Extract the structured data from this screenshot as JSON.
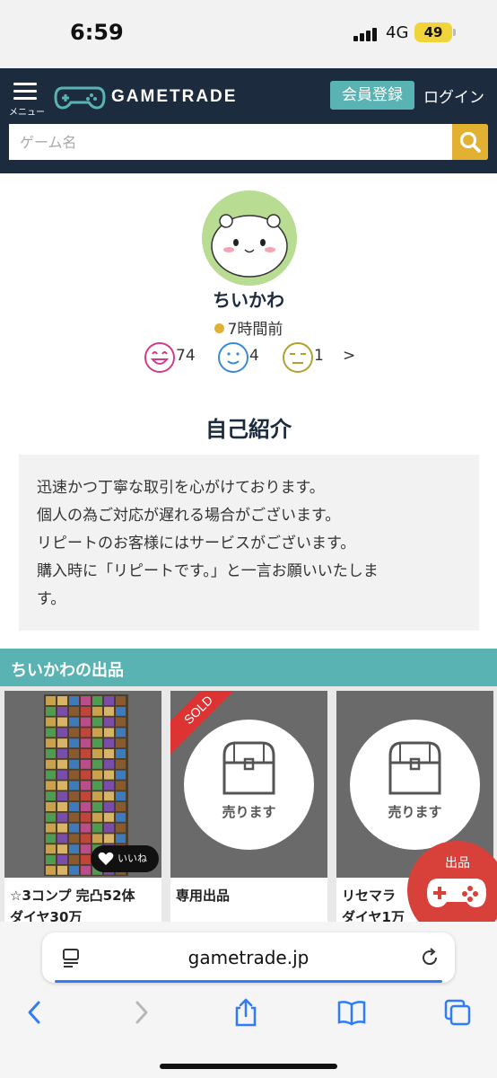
{
  "status_bar": {
    "time": "6:59",
    "network": "4G",
    "battery": "49"
  },
  "header": {
    "menu_label": "メニュー",
    "logo_text": "GAMETRADE",
    "register_label": "会員登録",
    "login_label": "ログイン",
    "search_placeholder": "ゲーム名"
  },
  "profile": {
    "username": "ちいかわ",
    "last_seen": "7時間前",
    "ratings": {
      "good": "74",
      "normal": "4",
      "bad": "1",
      "more": ">"
    }
  },
  "intro": {
    "title": "自己紹介",
    "lines": [
      "迅速かつ丁寧な取引を心がけております。",
      "個人の為ご対応が遅れる場合がございます。",
      "リピートのお客様にはサービスがございます。",
      "購入時に「リピートです。」と一言お願いいたしま",
      "す。"
    ]
  },
  "listings": {
    "title": "ちいかわの出品",
    "items": [
      {
        "title_lines": [
          "☆3コンプ 完凸52体",
          "ダイヤ30万"
        ],
        "like_label": "いいね"
      },
      {
        "title_lines": [
          "専用出品"
        ],
        "badge": "SOLD",
        "placeholder_label": "売ります"
      },
      {
        "title_lines": [
          "リセマラ",
          "ダイヤ1万"
        ],
        "placeholder_label": "売ります"
      }
    ]
  },
  "sell_button": {
    "label": "出品"
  },
  "browser": {
    "url": "gametrade.jp"
  },
  "colors": {
    "header_bg": "#1d2b3f",
    "accent_teal": "#5ab3b3",
    "accent_yellow": "#e3b132",
    "sell_red": "#d8413a"
  }
}
